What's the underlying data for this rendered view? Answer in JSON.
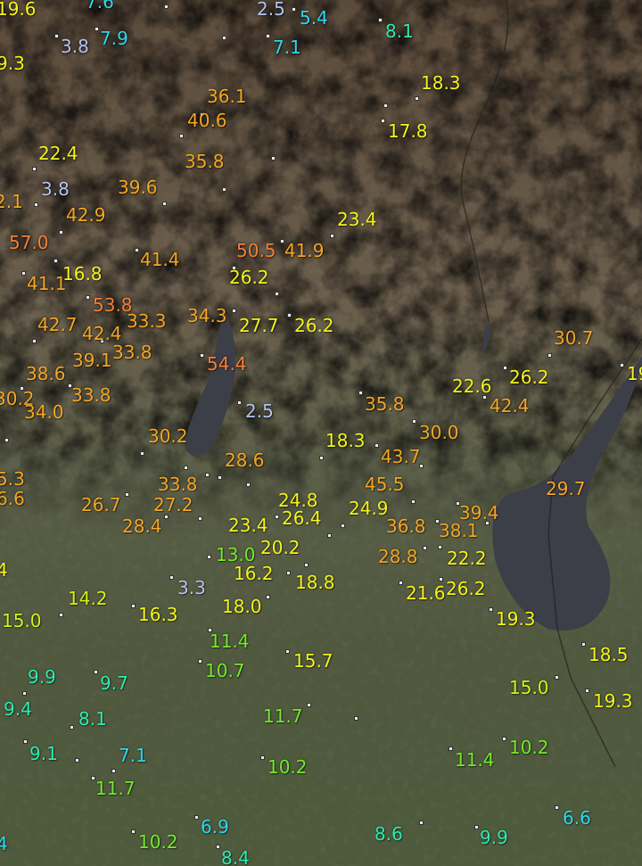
{
  "colors": {
    "blue": "#b4c4ee",
    "cyan": "#2fd8ee",
    "teal": "#2cecb0",
    "green": "#72ec2c",
    "lime": "#d2f214",
    "yellow": "#f4f41a",
    "orange": "#f4a624",
    "dorange": "#f4803a"
  },
  "readings": [
    {
      "text": "19.6",
      "c": "yellow"
    },
    {
      "text": "7.6",
      "c": "cyan"
    },
    {
      "text": "2.5",
      "c": "blue"
    },
    {
      "text": "5.4",
      "c": "cyan"
    },
    {
      "text": "8.1",
      "c": "teal"
    },
    {
      "text": "9.3",
      "c": "yellow"
    },
    {
      "text": "3.8",
      "c": "blue"
    },
    {
      "text": "7.9",
      "c": "cyan"
    },
    {
      "text": "7.1",
      "c": "cyan"
    },
    {
      "text": "18.3",
      "c": "yellow"
    },
    {
      "text": "36.1",
      "c": "orange"
    },
    {
      "text": "40.6",
      "c": "orange"
    },
    {
      "text": "17.8",
      "c": "yellow"
    },
    {
      "text": "35.8",
      "c": "orange"
    },
    {
      "text": "22.4",
      "c": "yellow"
    },
    {
      "text": "3.8",
      "c": "blue"
    },
    {
      "text": "39.6",
      "c": "orange"
    },
    {
      "text": "2.1",
      "c": "orange"
    },
    {
      "text": "42.9",
      "c": "orange"
    },
    {
      "text": "23.4",
      "c": "yellow"
    },
    {
      "text": "57.0",
      "c": "dorange"
    },
    {
      "text": "50.5",
      "c": "dorange"
    },
    {
      "text": "41.9",
      "c": "orange"
    },
    {
      "text": "41.4",
      "c": "orange"
    },
    {
      "text": "16.8",
      "c": "yellow"
    },
    {
      "text": "26.2",
      "c": "yellow"
    },
    {
      "text": "41.1",
      "c": "orange"
    },
    {
      "text": "53.8",
      "c": "dorange"
    },
    {
      "text": "33.3",
      "c": "orange"
    },
    {
      "text": "34.3",
      "c": "orange"
    },
    {
      "text": "27.7",
      "c": "yellow"
    },
    {
      "text": "26.2",
      "c": "yellow"
    },
    {
      "text": "42.7",
      "c": "orange"
    },
    {
      "text": "42.4",
      "c": "orange"
    },
    {
      "text": "39.1",
      "c": "orange"
    },
    {
      "text": "33.8",
      "c": "orange"
    },
    {
      "text": "30.7",
      "c": "orange"
    },
    {
      "text": "54.4",
      "c": "dorange"
    },
    {
      "text": "38.6",
      "c": "orange"
    },
    {
      "text": "26.2",
      "c": "yellow"
    },
    {
      "text": "22.6",
      "c": "yellow"
    },
    {
      "text": "19",
      "c": "yellow"
    },
    {
      "text": "30.2",
      "c": "orange"
    },
    {
      "text": "33.8",
      "c": "orange"
    },
    {
      "text": "34.0",
      "c": "orange"
    },
    {
      "text": "35.8",
      "c": "orange"
    },
    {
      "text": "42.4",
      "c": "orange"
    },
    {
      "text": "2.5",
      "c": "blue"
    },
    {
      "text": "30.0",
      "c": "orange"
    },
    {
      "text": "30.2",
      "c": "orange"
    },
    {
      "text": "18.3",
      "c": "yellow"
    },
    {
      "text": "43.7",
      "c": "orange"
    },
    {
      "text": "28.6",
      "c": "orange"
    },
    {
      "text": "5.3",
      "c": "orange"
    },
    {
      "text": "33.8",
      "c": "orange"
    },
    {
      "text": "45.5",
      "c": "orange"
    },
    {
      "text": "29.7",
      "c": "orange"
    },
    {
      "text": "6.6",
      "c": "orange"
    },
    {
      "text": "26.7",
      "c": "orange"
    },
    {
      "text": "27.2",
      "c": "orange"
    },
    {
      "text": "24.8",
      "c": "yellow"
    },
    {
      "text": "24.9",
      "c": "yellow"
    },
    {
      "text": "39.4",
      "c": "orange"
    },
    {
      "text": "28.4",
      "c": "orange"
    },
    {
      "text": "23.4",
      "c": "yellow"
    },
    {
      "text": "26.4",
      "c": "yellow"
    },
    {
      "text": "36.8",
      "c": "orange"
    },
    {
      "text": "38.1",
      "c": "orange"
    },
    {
      "text": "13.0",
      "c": "green"
    },
    {
      "text": "20.2",
      "c": "yellow"
    },
    {
      "text": "28.8",
      "c": "orange"
    },
    {
      "text": "22.2",
      "c": "yellow"
    },
    {
      "text": "4",
      "c": "yellow"
    },
    {
      "text": "16.2",
      "c": "yellow"
    },
    {
      "text": "18.8",
      "c": "yellow"
    },
    {
      "text": "3.3",
      "c": "blue"
    },
    {
      "text": "21.6",
      "c": "yellow"
    },
    {
      "text": "26.2",
      "c": "yellow"
    },
    {
      "text": "14.2",
      "c": "lime"
    },
    {
      "text": "16.3",
      "c": "yellow"
    },
    {
      "text": "18.0",
      "c": "yellow"
    },
    {
      "text": "15.0",
      "c": "lime"
    },
    {
      "text": "19.3",
      "c": "yellow"
    },
    {
      "text": "11.4",
      "c": "green"
    },
    {
      "text": "18.5",
      "c": "yellow"
    },
    {
      "text": "10.7",
      "c": "green"
    },
    {
      "text": "15.7",
      "c": "yellow"
    },
    {
      "text": "9.9",
      "c": "teal"
    },
    {
      "text": "9.7",
      "c": "teal"
    },
    {
      "text": "15.0",
      "c": "lime"
    },
    {
      "text": "9.4",
      "c": "teal"
    },
    {
      "text": "19.3",
      "c": "yellow"
    },
    {
      "text": "8.1",
      "c": "teal"
    },
    {
      "text": "11.7",
      "c": "green"
    },
    {
      "text": "9.1",
      "c": "teal"
    },
    {
      "text": "7.1",
      "c": "cyan"
    },
    {
      "text": "11.4",
      "c": "green"
    },
    {
      "text": "10.2",
      "c": "green"
    },
    {
      "text": "10.2",
      "c": "green"
    },
    {
      "text": "8.6",
      "c": "teal"
    },
    {
      "text": "11.7",
      "c": "green"
    },
    {
      "text": "6.6",
      "c": "cyan"
    },
    {
      "text": "6.9",
      "c": "cyan"
    },
    {
      "text": "10.2",
      "c": "green"
    },
    {
      "text": "9.9",
      "c": "teal"
    },
    {
      "text": "8.4",
      "c": "teal"
    },
    {
      "text": "4",
      "c": "cyan"
    }
  ]
}
